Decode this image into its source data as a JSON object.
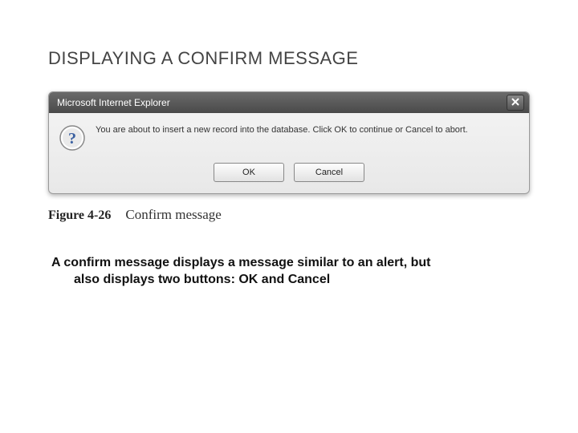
{
  "slide": {
    "title": "DISPLAYING A CONFIRM MESSAGE",
    "description_line1": "A confirm message displays a message similar to an alert, but",
    "description_line2": "also displays two buttons: OK and Cancel"
  },
  "dialog": {
    "titlebar": "Microsoft Internet Explorer",
    "message": "You are about to insert a new record into the database. Click OK to continue or Cancel to abort.",
    "ok_label": "OK",
    "cancel_label": "Cancel"
  },
  "figure": {
    "label": "Figure 4-26",
    "caption": "Confirm message"
  }
}
